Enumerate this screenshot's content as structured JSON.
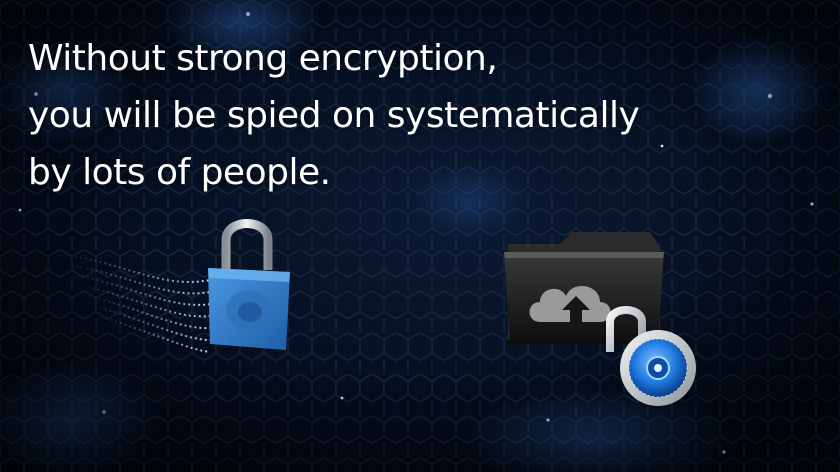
{
  "slide": {
    "headline_lines": [
      "Without strong encryption,",
      "you will be spied on systematically",
      "by lots of people."
    ]
  },
  "colors": {
    "background": "#050b18",
    "hex_glow": "#1e6bff",
    "headline_text": "#ffffff",
    "padlock_blue": "#2a78c8",
    "combo_lock_blue": "#1e90ff"
  },
  "icons": {
    "padlock": "padlock-icon",
    "binary_stream": "binary-stream-icon",
    "folder": "folder-icon",
    "cloud_upload": "cloud-upload-icon",
    "combination_lock": "combination-lock-icon"
  }
}
